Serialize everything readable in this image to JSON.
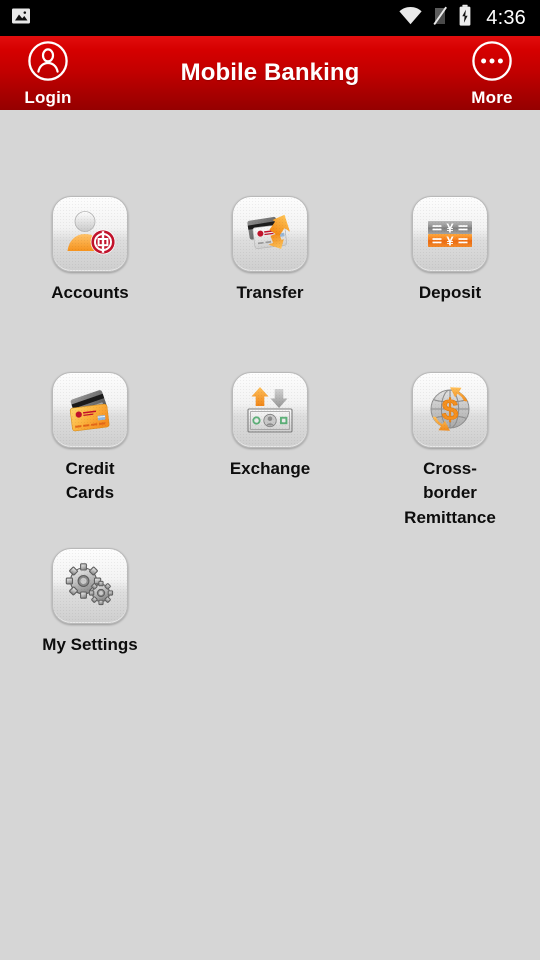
{
  "statusbar": {
    "time": "4:36",
    "icons": {
      "photo": "photo-image-icon",
      "wifi": "wifi-icon",
      "signal": "signal-off-icon",
      "battery": "battery-charging-icon"
    }
  },
  "header": {
    "title": "Mobile Banking",
    "login_label": "Login",
    "more_label": "More",
    "login_icon": "user-circle-icon",
    "more_icon": "more-dots-circle-icon",
    "bg_top": "#e20e0e",
    "bg_bottom": "#950000",
    "text_color": "#ffffff"
  },
  "theme": {
    "page_bg": "#d6d6d6",
    "accent_red": "#c20000",
    "accent_orange": "#f59422",
    "label_color": "#0d0d0d",
    "statusbar_bg": "#000000"
  },
  "menu": {
    "items": [
      {
        "label": "Accounts",
        "icon": "accounts-person-badge-icon"
      },
      {
        "label": "Transfer",
        "icon": "transfer-cards-arrow-icon"
      },
      {
        "label": "Deposit",
        "icon": "deposit-yen-bars-icon"
      },
      {
        "label": "Credit Cards",
        "icon": "credit-cards-icon"
      },
      {
        "label": "Exchange",
        "icon": "exchange-banknote-arrows-icon"
      },
      {
        "label": "Cross-border Remittance",
        "icon": "cross-border-globe-dollar-icon"
      },
      {
        "label": "My Settings",
        "icon": "settings-gears-icon"
      }
    ]
  }
}
